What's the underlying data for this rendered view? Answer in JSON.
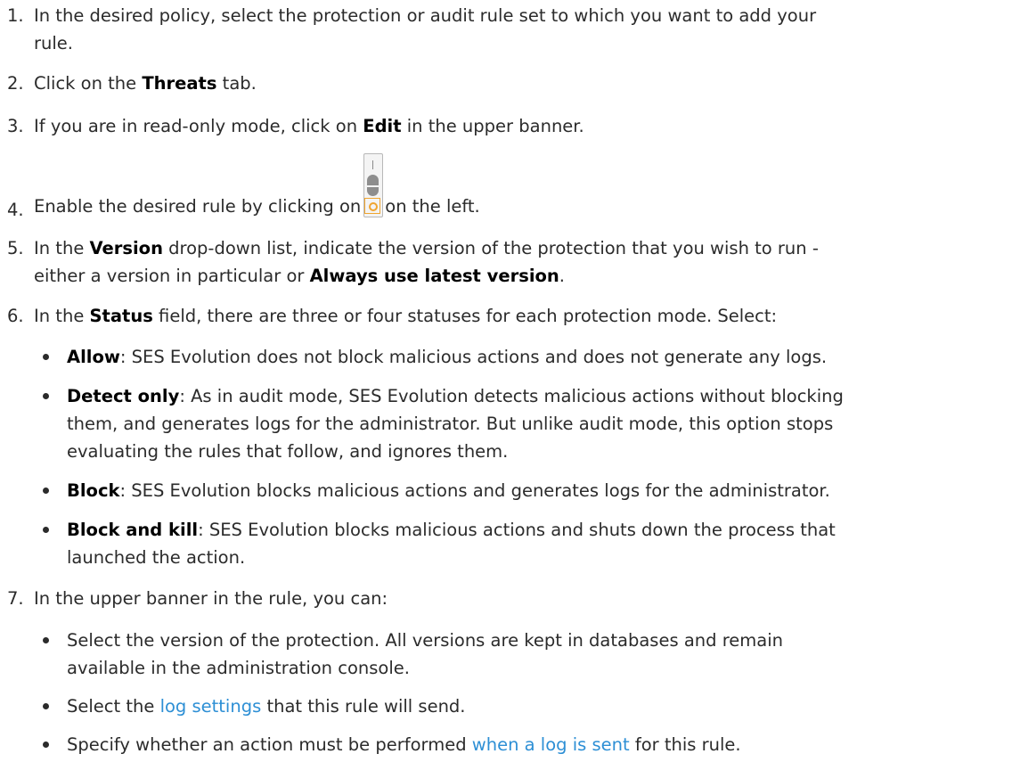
{
  "steps": [
    {
      "num": "1.",
      "a": "In the desired policy, select the protection or audit rule set to which you want to add your",
      "b": "rule."
    },
    {
      "num": "2.",
      "pre": "Click on the ",
      "bold": "Threats",
      "post": " tab."
    },
    {
      "num": "3.",
      "pre": "If you are in read-only mode, click on ",
      "bold": "Edit",
      "post": " in the upper banner."
    },
    {
      "num": "4.",
      "pre": "Enable the desired rule by clicking on",
      "icon": "toggle-switch-icon",
      "post": "on the left."
    },
    {
      "num": "5.",
      "pre": "In the ",
      "bold": "Version",
      "mid": " drop-down list, indicate the version of the protection that you wish to run -",
      "line2pre": "either a version in particular or ",
      "line2bold": "Always use latest version",
      "line2post": "."
    },
    {
      "num": "6.",
      "pre": "In the ",
      "bold": "Status",
      "post": " field, there are three or four statuses for each protection mode. Select:",
      "bullets": [
        {
          "bold": "Allow",
          "lines": [
            ": SES Evolution does not block malicious actions and does not generate any logs."
          ]
        },
        {
          "bold": "Detect only",
          "lines": [
            ": As in audit mode, SES Evolution detects malicious actions without blocking",
            "them, and generates logs for the administrator. But unlike audit mode, this option stops",
            "evaluating the rules that follow, and ignores them."
          ]
        },
        {
          "bold": "Block",
          "lines": [
            ": SES Evolution blocks malicious actions and generates logs for the administrator."
          ]
        },
        {
          "bold": "Block and kill",
          "lines": [
            ": SES Evolution blocks malicious actions and shuts down the process that",
            "launched the action."
          ]
        }
      ]
    },
    {
      "num": "7.",
      "text": "In the upper banner in the rule, you can:",
      "bullets": [
        {
          "lines": [
            "Select the version of the protection. All versions are kept in databases and remain",
            "available in the administration console."
          ]
        },
        {
          "pre": "Select the ",
          "link": "log settings",
          "post": " that this rule will send."
        },
        {
          "pre": "Specify whether an action must be performed ",
          "link": "when a log is sent",
          "post": " for this rule."
        }
      ]
    }
  ],
  "colors": {
    "text": "#2b2b2b",
    "link": "#2d8fd5",
    "toggle_accent": "#f0a530"
  }
}
